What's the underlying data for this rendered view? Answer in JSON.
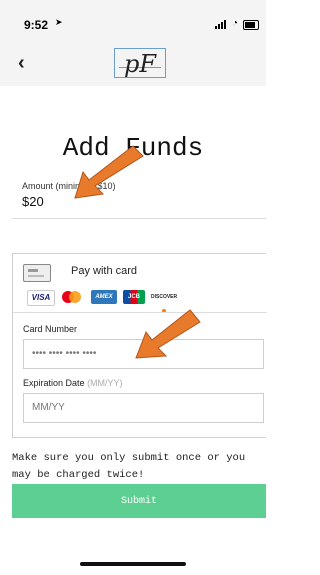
{
  "status_bar": {
    "time": "9:52",
    "location_icon": "location-arrow-icon"
  },
  "nav": {
    "back_icon": "chevron-left-icon",
    "back_glyph": "‹",
    "logo_text": "pF"
  },
  "page": {
    "title": "Add Funds"
  },
  "amount": {
    "label": "Amount (minimum $10)",
    "value": "$20"
  },
  "card": {
    "pay_label": "Pay with card",
    "brands": [
      "VISA",
      "Mastercard",
      "AMEX",
      "JCB",
      "DISCOVER"
    ],
    "card_number_label": "Card Number",
    "card_number_value": "•••• •••• •••• ••••",
    "expiration_label": "Expiration Date",
    "expiration_hint": "(MM/YY)",
    "expiration_placeholder": "MM/YY"
  },
  "warning": "Make sure you only submit once or you may be charged twice!",
  "submit": {
    "label": "Submit"
  },
  "colors": {
    "accent": "#5ecf93",
    "annotation_arrow": "#e87a2c",
    "logo_border": "#6a9ecf"
  }
}
